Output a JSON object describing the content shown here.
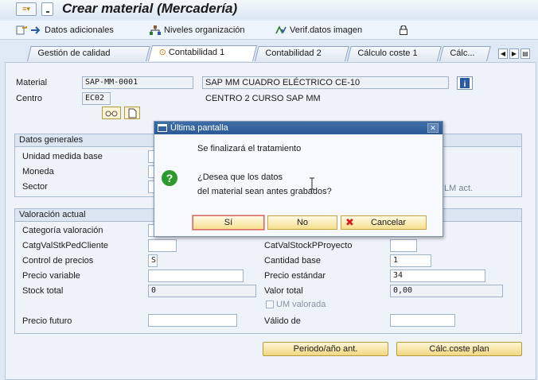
{
  "window": {
    "title": "Crear material (Mercadería)"
  },
  "toolbar": {
    "additional_data": "Datos adicionales",
    "org_levels": "Niveles organización",
    "check_screen_data": "Verif.datos imagen"
  },
  "tabs": [
    "Gestión de calidad",
    "Contabilidad 1",
    "Contabilidad 2",
    "Cálculo coste 1",
    "Cálc..."
  ],
  "header": {
    "material_label": "Material",
    "material_value": "SAP-MM-0001",
    "material_desc": "SAP MM CUADRO ELÉCTRICO CE-10",
    "plant_label": "Centro",
    "plant_value": "EC02",
    "plant_desc": "CENTRO 2 CURSO SAP MM"
  },
  "general": {
    "title": "Datos generales",
    "base_uom_label": "Unidad medida base",
    "currency_label": "Moneda",
    "sector_label": "Sector",
    "ml_act": "LM act."
  },
  "valuation": {
    "title": "Valoración actual",
    "val_class_label": "Categoría valoración",
    "vc_sales_label": "CatgValStkPedCliente",
    "proj_stock_label": "CatValStockPProyecto",
    "price_control_label": "Control de precios",
    "price_control_value": "S",
    "price_unit_label": "Cantidad base",
    "price_unit_value": "1",
    "moving_price_label": "Precio variable",
    "standard_price_label": "Precio estándar",
    "standard_price_value": "34",
    "total_stock_label": "Stock total",
    "total_stock_value": "0",
    "total_value_label": "Valor total",
    "total_value_value": "0,00",
    "valuated_uom_label": "UM valorada",
    "future_price_label": "Precio futuro",
    "valid_from_label": "Válido de"
  },
  "buttons": {
    "period_prev": "Periodo/año ant.",
    "cost_plan": "Cálc.coste plan"
  },
  "dialog": {
    "title": "Última pantalla",
    "message1": "Se finalizará el tratamiento",
    "question_line1": "¿Desea que los datos",
    "question_line2": "del material sean antes grabados?",
    "yes": "Sí",
    "no": "No",
    "cancel": "Cancelar"
  },
  "colors": {
    "dialog_title_bg": "#2c5a95",
    "button_yellow": "#f1d780",
    "question_icon": "#2c9a2c",
    "cancel_icon": "#d02020"
  }
}
